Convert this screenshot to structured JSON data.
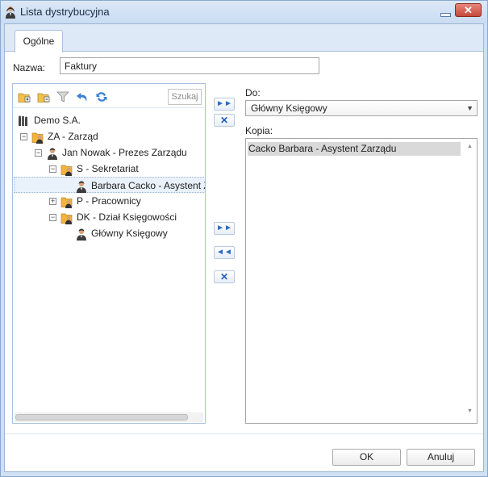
{
  "window": {
    "title": "Lista dystrybucyjna",
    "close_glyph": "✕",
    "minimize_icon": "minimize-icon"
  },
  "tabs": [
    {
      "label": "Ogólne",
      "active": true
    }
  ],
  "name_field": {
    "label": "Nazwa:",
    "value": "Faktury"
  },
  "tree": {
    "toolbar_icons": [
      "expand-all-icon",
      "collapse-all-icon",
      "filter-icon",
      "undo-icon",
      "refresh-icon"
    ],
    "search_label": "Szukaj",
    "nodes": [
      {
        "label": "Demo S.A.",
        "icon": "company-icon",
        "expander": ""
      },
      {
        "label": "ZA - Zarząd",
        "icon": "department-icon",
        "expander": "−"
      },
      {
        "label": "Jan Nowak - Prezes Zarządu",
        "icon": "person-icon",
        "expander": "−"
      },
      {
        "label": "S - Sekretariat",
        "icon": "department-icon",
        "expander": "−"
      },
      {
        "label": "Barbara Cacko - Asystent Zarządu",
        "icon": "person-icon",
        "expander": "",
        "selected": true
      },
      {
        "label": "P - Pracownicy",
        "icon": "department-icon",
        "expander": "+"
      },
      {
        "label": "DK - Dział Księgowości",
        "icon": "department-icon",
        "expander": "−"
      },
      {
        "label": "Główny Księgowy",
        "icon": "person-icon",
        "expander": ""
      }
    ]
  },
  "buttons": {
    "add_to_glyph": "►►",
    "remove_to_glyph": "✕",
    "add_copy_glyph": "►►",
    "remove_copy_all_glyph": "◄◄",
    "remove_copy_glyph": "✕"
  },
  "do_field": {
    "label": "Do:",
    "value": "Główny Księgowy"
  },
  "kopia_field": {
    "label": "Kopia:",
    "items": [
      "Cacko Barbara - Asystent Zarządu"
    ]
  },
  "footer": {
    "ok_label": "OK",
    "cancel_label": "Anuluj"
  },
  "colors": {
    "window_border": "#8aa9d0",
    "close_button": "#c44a3c",
    "accent_blue": "#2a6cc4",
    "selection_row": "#e9f1fb"
  }
}
